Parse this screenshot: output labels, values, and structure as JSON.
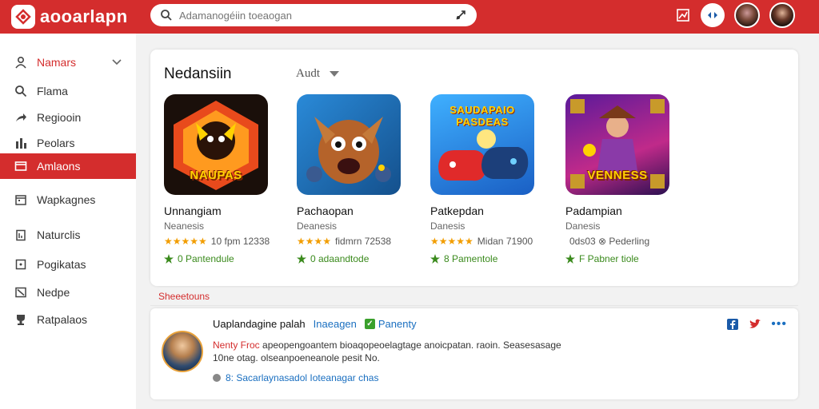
{
  "header": {
    "logo_text": "aooarlapn",
    "search_placeholder": "Adamanogéiin toeaogan"
  },
  "sidebar": {
    "items": [
      {
        "label": "Namars",
        "icon": "user-icon"
      },
      {
        "label": "Flama",
        "icon": "search-icon"
      },
      {
        "label": "Regiooin",
        "icon": "share-icon"
      },
      {
        "label": "Peolars",
        "icon": "bar-chart-icon"
      },
      {
        "label": "Amlaons",
        "icon": "folder-icon",
        "active": true
      },
      {
        "label": "Wapkagnes",
        "icon": "calendar-icon"
      },
      {
        "label": "Naturclis",
        "icon": "clipboard-icon"
      },
      {
        "label": "Pogikatas",
        "icon": "document-icon"
      },
      {
        "label": "Nedpe",
        "icon": "note-icon"
      },
      {
        "label": "Ratpalaos",
        "icon": "trophy-icon"
      }
    ]
  },
  "featured": {
    "title": "Nedansiin",
    "filter_label": "Audt",
    "games": [
      {
        "art_text": "NAUPAS",
        "name": "Unnangiam",
        "subtitle": "Neanesis",
        "stars": "★★★★★",
        "rating_text": "10 fpm 12338",
        "tag": "0 Pantendule",
        "accent": "#e24b1e"
      },
      {
        "art_text": "",
        "name": "Pachaopan",
        "subtitle": "Deanesis",
        "stars": "★★★★",
        "rating_text": "fidmrn 72538",
        "tag": "0 adaandtode",
        "accent": "#1f7ec0"
      },
      {
        "art_text": "SAUDAPAIO PASDEAS",
        "name": "Patkepdan",
        "subtitle": "Danesis",
        "stars": "★★★★★",
        "rating_text": "Midan 71900",
        "tag": "8 Pamentole",
        "accent": "#2d7bd0"
      },
      {
        "art_text": "VENNESS",
        "name": "Padampian",
        "subtitle": "Danesis",
        "stars": "",
        "rating_text": "0ds03 ⊗ Pederling",
        "tag": "F Pabner tiole",
        "accent": "#7a2aa8"
      }
    ]
  },
  "section_label": "Sheeetouns",
  "post": {
    "author": "Uaplandagine palah",
    "link": "Inaeagen",
    "badge": "Panenty",
    "body_highlight": "Nenty Froc",
    "body": "apeopengoantem bioaqopeoelagtage anoicpatan. raoin. Seasesasage 10ne otag. olseanpoeneanole pesit No.",
    "footer": "8: Sacarlaynasadol Ioteanagar chas"
  }
}
